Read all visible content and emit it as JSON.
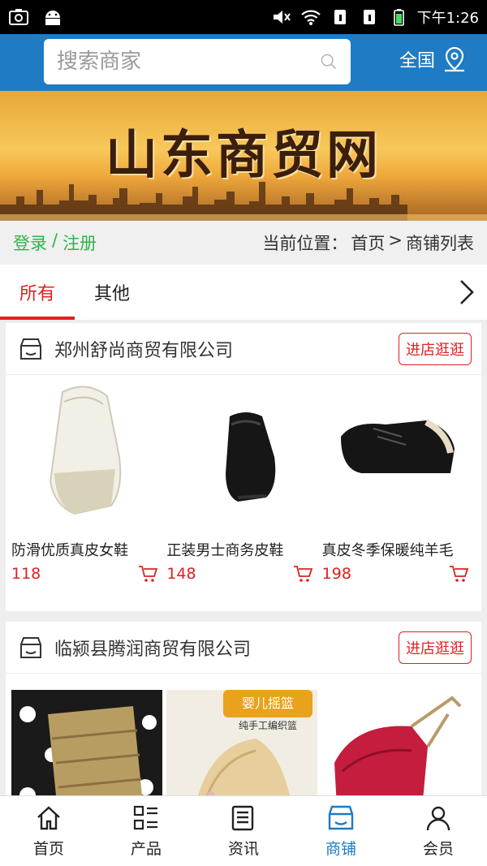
{
  "status_bar": {
    "time": "下午1:26"
  },
  "header": {
    "search_placeholder": "搜索商家",
    "region_label": "全国"
  },
  "banner": {
    "title": "山东商贸网"
  },
  "breadcrumb": {
    "login": "登录",
    "separator": "/",
    "register": "注册",
    "location_prefix": "当前位置：",
    "home": "首页",
    "arrow": ">",
    "current": "商铺列表"
  },
  "tabs": [
    {
      "label": "所有"
    },
    {
      "label": "其他"
    }
  ],
  "shops": [
    {
      "name": "郑州舒尚商贸有限公司",
      "visit_label": "进店逛逛",
      "products": [
        {
          "name": "防滑优质真皮女鞋",
          "price": "118"
        },
        {
          "name": "正装男士商务皮鞋",
          "price": "148"
        },
        {
          "name": "真皮冬季保暖纯羊毛",
          "price": "198"
        }
      ]
    },
    {
      "name": "临颍县腾润商贸有限公司",
      "visit_label": "进店逛逛",
      "products": [
        {
          "name": "",
          "price": "",
          "image_text": ""
        },
        {
          "name": "",
          "price": "",
          "image_text": "婴儿摇篮 纯手工编织篮"
        },
        {
          "name": "",
          "price": "",
          "image_text": ""
        }
      ]
    }
  ],
  "bottom_nav": [
    {
      "label": "首页",
      "icon": "home-icon"
    },
    {
      "label": "产品",
      "icon": "grid-list-icon"
    },
    {
      "label": "资讯",
      "icon": "news-icon"
    },
    {
      "label": "商铺",
      "icon": "shop-icon"
    },
    {
      "label": "会员",
      "icon": "user-icon"
    }
  ],
  "colors": {
    "header_blue": "#1e7bc4",
    "accent_red": "#e02020",
    "green": "#2db548"
  }
}
